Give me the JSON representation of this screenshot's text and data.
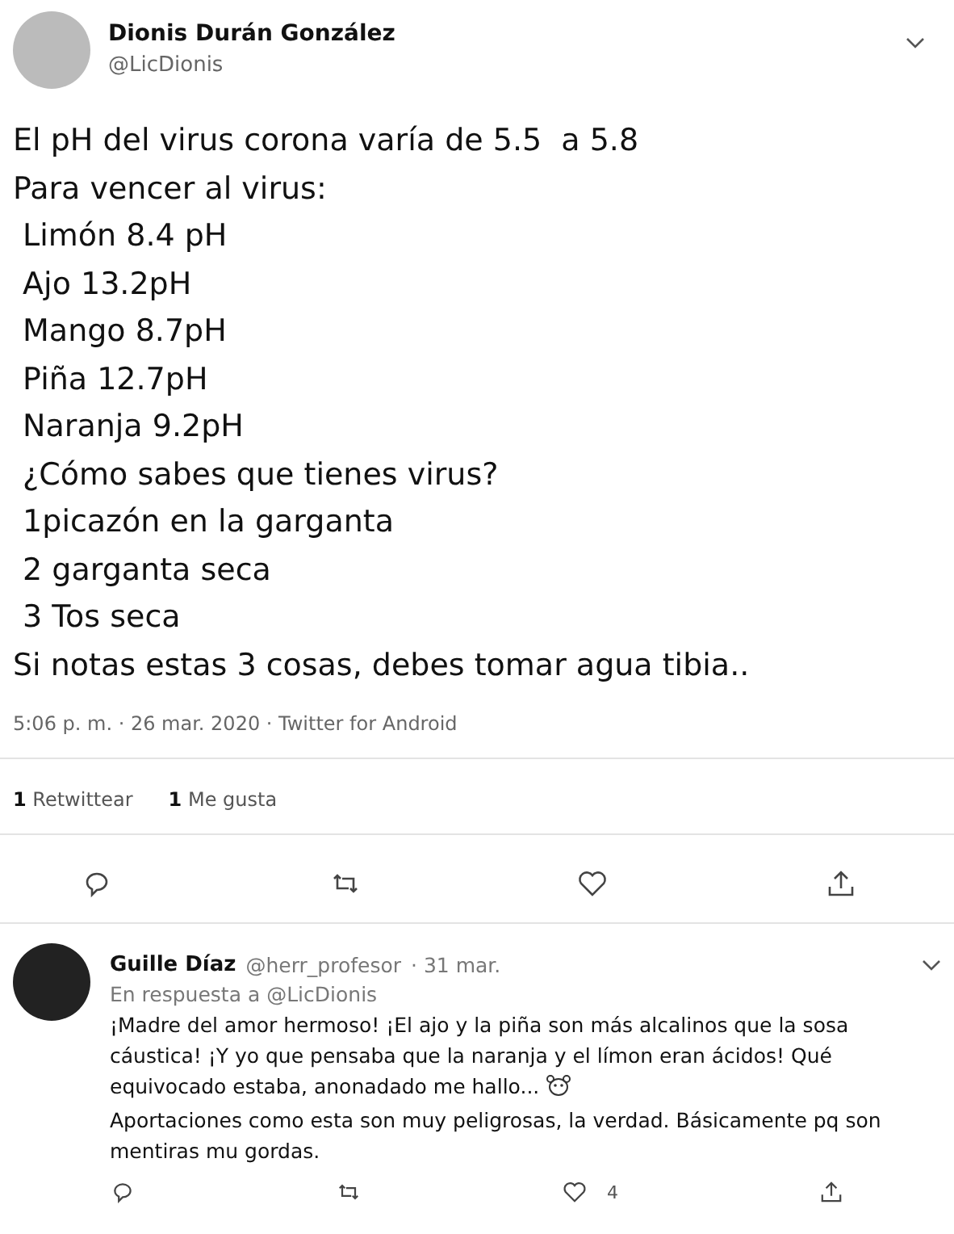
{
  "tweet": {
    "name": "Dionis Durán González",
    "handle": "@LicDionis",
    "lines": [
      "El pH del virus corona varía de 5.5  a 5.8",
      "Para vencer al virus:",
      " Limón 8.4 pH",
      " Ajo 13.2pH",
      " Mango 8.7pH",
      " Piña 12.7pH",
      " Naranja 9.2pH",
      " ¿Cómo sabes que tienes virus?",
      " 1picazón en la garganta",
      " 2 garganta seca",
      " 3 Tos seca",
      "Si notas estas 3 cosas, debes tomar agua tibia.."
    ],
    "meta": "5:06 p. m. · 26 mar. 2020 · Twitter for Android",
    "stats": [
      {
        "count": "1",
        "label": "Retwittear"
      },
      {
        "count": "1",
        "label": "Me gusta"
      }
    ]
  },
  "reply": {
    "name": "Guille Díaz",
    "handle": "@herr_profesor",
    "date": "· 31 mar.",
    "in_reply_to": "En respuesta a @LicDionis",
    "paragraphs": [
      "¡Madre del amor hermoso! ¡El ajo y la piña son más alcalinos que la sosa cáustica! ¡Y yo que pensaba que la naranja y el límon eran ácidos! Qué equivocado estaba, anonadado me hallo...",
      "Aportaciones como esta son muy peligrosas, la verdad. Básicamente pq son mentiras mu gordas."
    ],
    "like_count": "4"
  }
}
